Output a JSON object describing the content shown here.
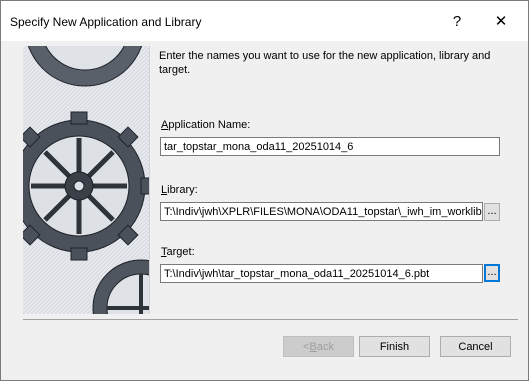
{
  "window": {
    "title": "Specify New Application and Library",
    "help_glyph": "?",
    "close_glyph": "✕"
  },
  "description": "Enter the names you want to use for the new application, library and target.",
  "fields": {
    "application": {
      "label_underline": "A",
      "label_rest": "pplication Name:",
      "value": "tar_topstar_mona_oda11_20251014_6"
    },
    "library": {
      "label_underline": "L",
      "label_rest": "ibrary:",
      "value": "T:\\Indiv\\jwh\\XPLR\\FILES\\MONA\\ODA11_topstar\\_iwh_im_worklib.",
      "browse": "..."
    },
    "target": {
      "label_underline": "T",
      "label_rest": "arget:",
      "value": "T:\\Indiv\\jwh\\tar_topstar_mona_oda11_20251014_6.pbt",
      "browse": "..."
    }
  },
  "buttons": {
    "back": {
      "prefix": "< ",
      "underline": "B",
      "rest": "ack"
    },
    "finish": "Finish",
    "cancel": "Cancel"
  },
  "icons": [
    "gear-illustration",
    "help-icon",
    "close-icon"
  ]
}
